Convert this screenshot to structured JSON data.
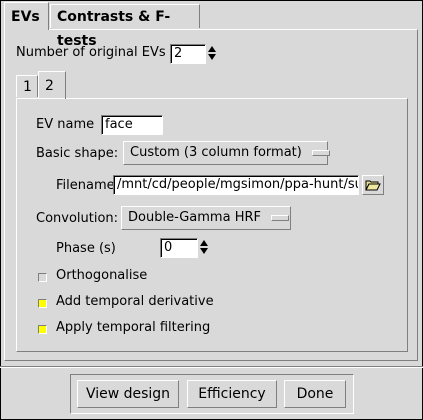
{
  "tabs": {
    "evs": "EVs",
    "contrasts": "Contrasts & F-tests"
  },
  "num_evs": {
    "label": "Number of original EVs",
    "value": "2"
  },
  "ev_tabs": [
    "1",
    "2"
  ],
  "ev_name": {
    "label": "EV name",
    "value": "face"
  },
  "basic_shape": {
    "label": "Basic shape:",
    "value": "Custom (3 column format)"
  },
  "filename": {
    "label": "Filename",
    "value": "/mnt/cd/people/mgsimon/ppa-hunt/subj"
  },
  "convolution": {
    "label": "Convolution:",
    "value": "Double-Gamma HRF"
  },
  "phase": {
    "label": "Phase (s)",
    "value": "0"
  },
  "options": [
    {
      "label": "Orthogonalise",
      "checked": false
    },
    {
      "label": "Add temporal derivative",
      "checked": true
    },
    {
      "label": "Apply temporal filtering",
      "checked": true
    }
  ],
  "buttons": {
    "view_design": "View design",
    "efficiency": "Efficiency",
    "done": "Done"
  },
  "colors": {
    "background": "#d9d9d9",
    "check_on": "#ffff00"
  },
  "icons": {
    "folder": "folder-open-icon"
  }
}
